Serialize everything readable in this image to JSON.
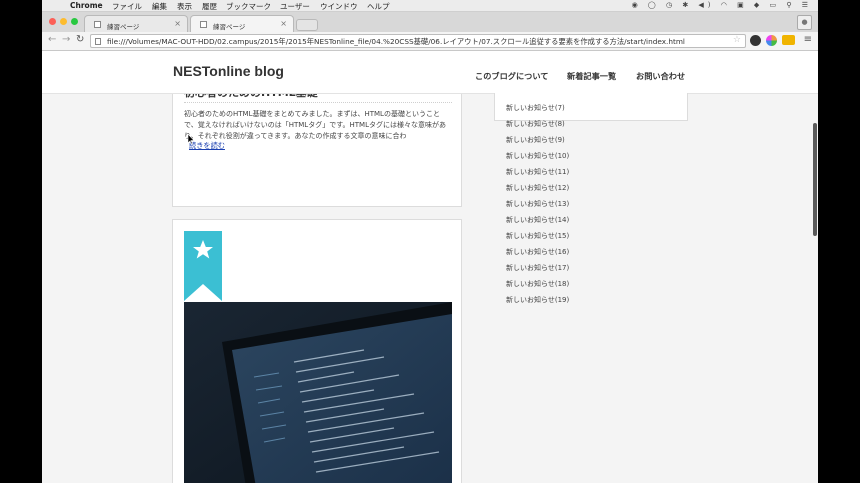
{
  "menubar": {
    "app": "Chrome",
    "items": [
      "ファイル",
      "編集",
      "表示",
      "履歴",
      "ブックマーク",
      "ユーザー",
      "ウインドウ",
      "ヘルプ"
    ]
  },
  "tabs": [
    {
      "label": "練習ページ",
      "active": false
    },
    {
      "label": "練習ページ",
      "active": true
    }
  ],
  "toolbar": {
    "url": "file:///Volumes/MAC-OUT-HDD/02.campus/2015年/2015年NESTonline_file/04.%20CSS基礎/06.レイアウト/07.スクロール追従する要素を作成する方法/start/index.html"
  },
  "site": {
    "logo": "NESTonline blog",
    "nav": [
      "このブログについて",
      "新着記事一覧",
      "お問い合わせ"
    ]
  },
  "article": {
    "title": "初心者のためのHTML基礎",
    "body": "初心者のためのHTML基礎をまとめてみました。まずは、HTMLの基礎ということで、覚えなければいけないのは「HTMLタグ」です。HTMLタグには様々な意味があり、それぞれ役割が違ってきます。あなたの作成する文章の意味に合わ",
    "more": "続きを読む"
  },
  "sidebar": {
    "items": [
      "新しいお知らせ(7)",
      "新しいお知らせ(8)",
      "新しいお知らせ(9)",
      "新しいお知らせ(10)",
      "新しいお知らせ(11)",
      "新しいお知らせ(12)",
      "新しいお知らせ(13)",
      "新しいお知らせ(14)",
      "新しいお知らせ(15)",
      "新しいお知らせ(16)",
      "新しいお知らせ(17)",
      "新しいお知らせ(18)",
      "新しいお知らせ(19)"
    ]
  },
  "colors": {
    "ribbon": "#3bbfd3",
    "link": "#1a3fb0"
  }
}
